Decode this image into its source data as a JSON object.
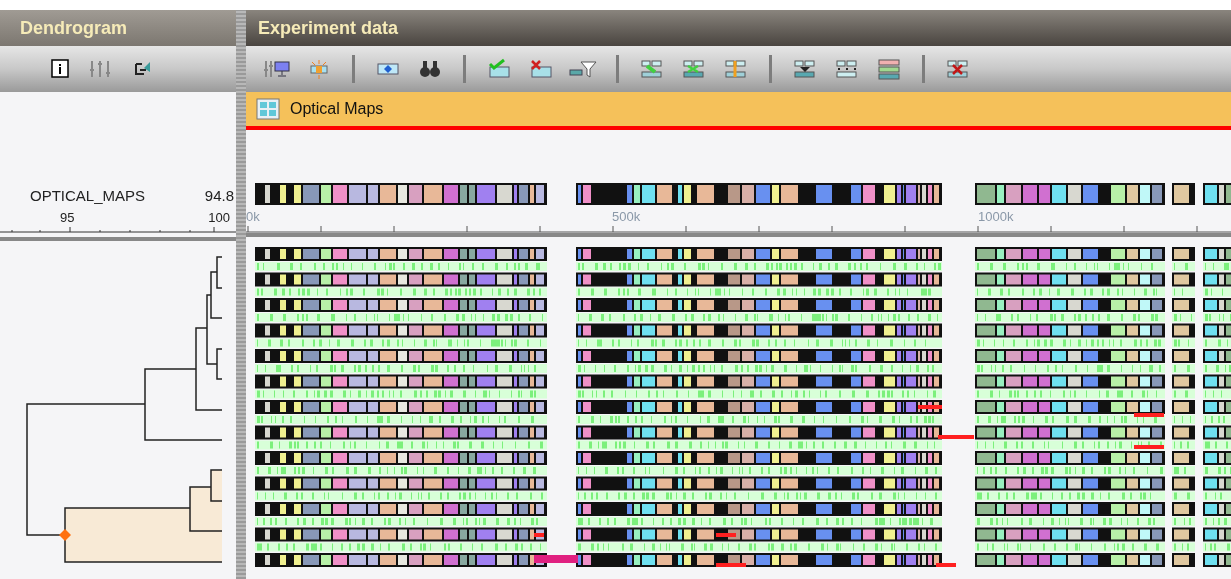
{
  "dendrogram": {
    "title": "Dendrogram",
    "column_label": "OPTICAL_MAPS",
    "column_value": "94.8",
    "scale_labels": [
      "95",
      "100"
    ]
  },
  "experiment": {
    "title": "Experiment data",
    "group": {
      "label": "Optical Maps"
    },
    "axis_labels": [
      "0k",
      "500k",
      "1000k"
    ]
  }
}
